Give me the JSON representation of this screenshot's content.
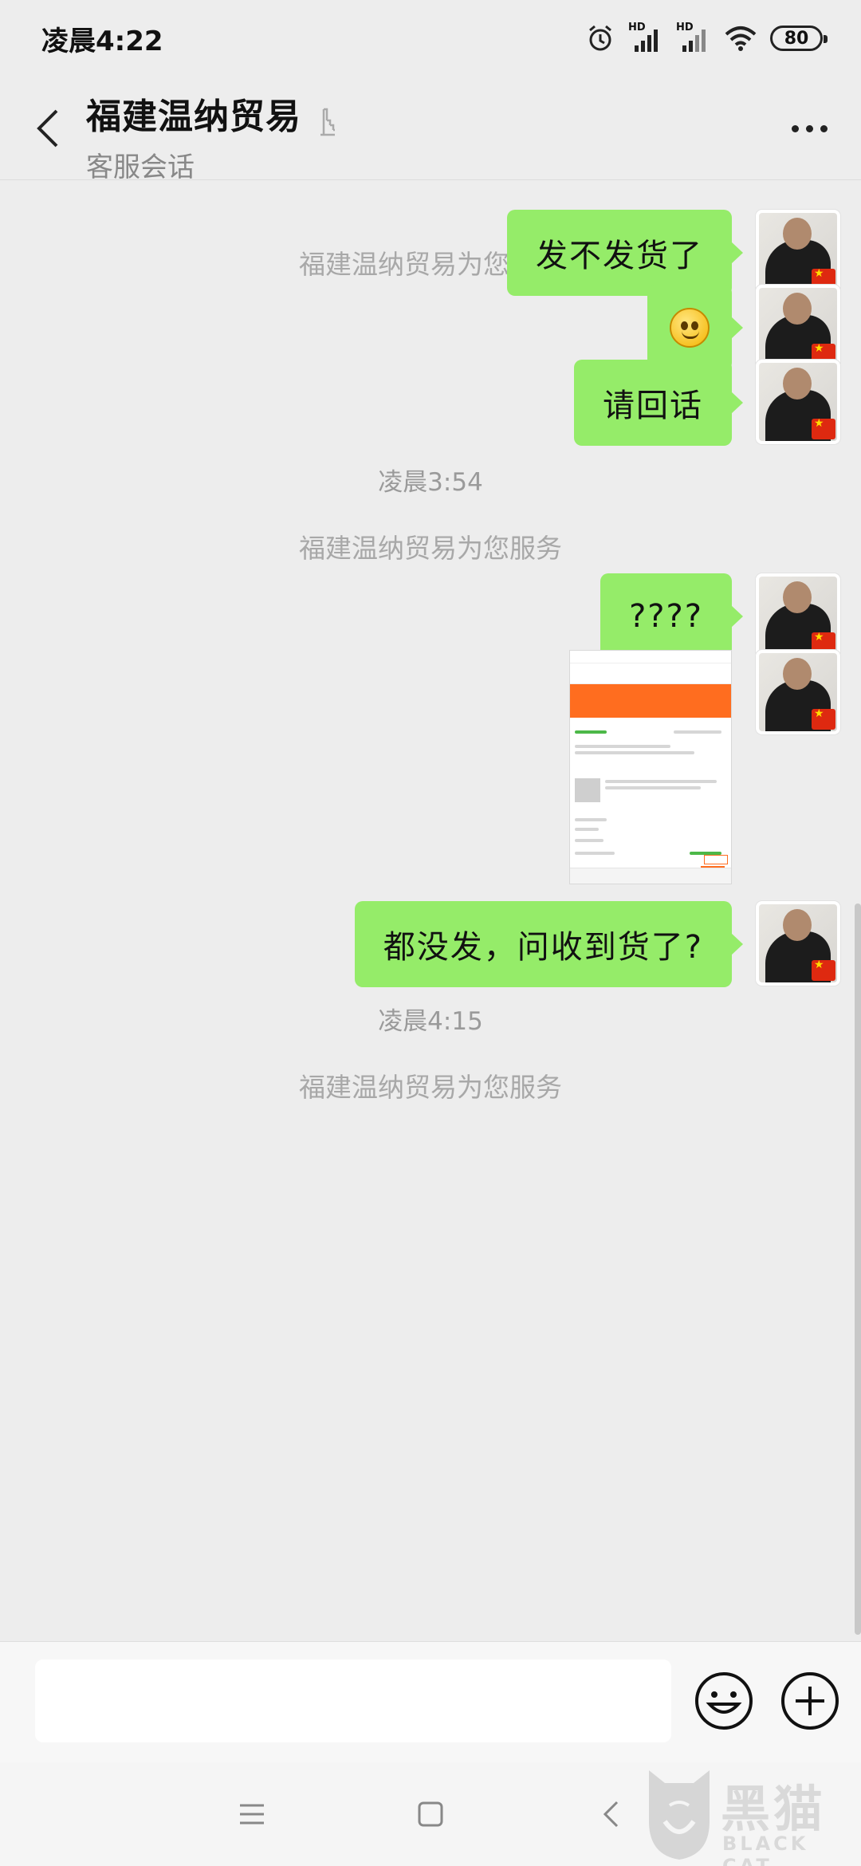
{
  "status_bar": {
    "time": "凌晨4:22",
    "signal_label_1": "HD",
    "signal_label_2": "HD",
    "battery": "80"
  },
  "header": {
    "title": "福建温纳贸易",
    "subtitle": "客服会话"
  },
  "chat": {
    "system_notice_1": "福建温纳贸易为您服务",
    "messages_1": [
      {
        "text": "发不发货了"
      },
      {
        "text": "",
        "emoji": "smile-emoji"
      },
      {
        "text": "请回话"
      }
    ],
    "timestamp_1": "凌晨3:54",
    "system_notice_2": "福建温纳贸易为您服务",
    "messages_2": [
      {
        "text": "????"
      },
      {
        "text": "",
        "image": "order-screenshot"
      },
      {
        "text": "都没发，问收到货了?"
      }
    ],
    "timestamp_2": "凌晨4:15",
    "system_notice_3": "福建温纳贸易为您服务"
  },
  "input_bar": {
    "placeholder": ""
  },
  "watermark": {
    "text": "黑猫",
    "sub": "BLACK CAT"
  },
  "colors": {
    "bubble": "#95ec69",
    "background": "#ededed",
    "system_text": "#a8a8a8"
  }
}
